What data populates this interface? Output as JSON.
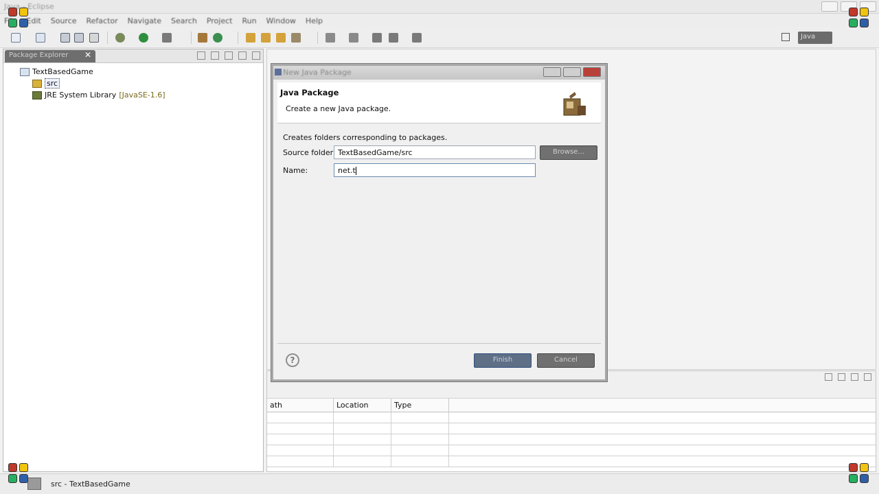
{
  "window": {
    "title": "Java - Eclipse"
  },
  "menubar": [
    "File",
    "Edit",
    "Source",
    "Refactor",
    "Navigate",
    "Search",
    "Project",
    "Run",
    "Window",
    "Help"
  ],
  "perspective": {
    "label": "Java"
  },
  "package_explorer": {
    "tab_label": "Package Explorer",
    "close_glyph": "✕",
    "tree": {
      "project": "TextBasedGame",
      "src": "src",
      "jre_label": "JRE System Library",
      "jre_version": "[JavaSE-1.6]"
    }
  },
  "dialog": {
    "title": "New Java Package",
    "header_title": "Java Package",
    "header_desc": "Create a new Java package.",
    "body_desc": "Creates folders corresponding to packages.",
    "source_folder_label": "Source folder:",
    "source_folder_value": "TextBasedGame/src",
    "name_label": "Name:",
    "name_value": "net.t",
    "browse_label": "Browse...",
    "finish_label": "Finish",
    "cancel_label": "Cancel",
    "help_glyph": "?"
  },
  "bottom_table": {
    "columns": [
      "ath",
      "Location",
      "Type"
    ]
  },
  "statusbar": {
    "text": "src - TextBasedGame"
  },
  "colors": {
    "red": "#c0392b",
    "yellow": "#f1c40f",
    "green": "#27ae60",
    "blue": "#2f5fa8"
  }
}
